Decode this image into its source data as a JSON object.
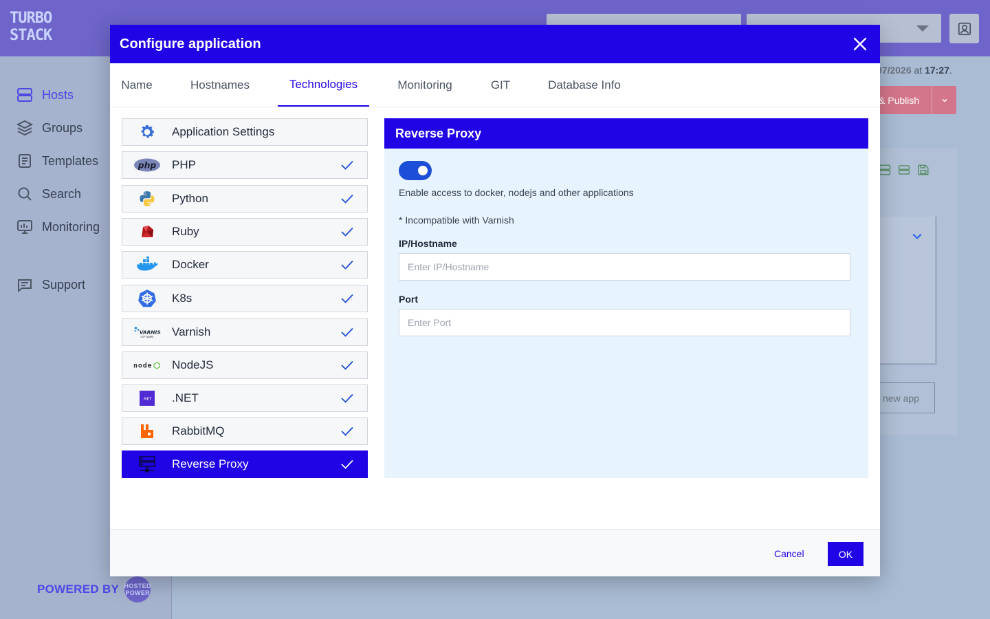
{
  "app": {
    "logo": "TURBO STACK",
    "powered_by": "POWERED BY"
  },
  "sidebar": {
    "items": [
      {
        "label": "Hosts",
        "icon": "server-icon"
      },
      {
        "label": "Groups",
        "icon": "layers-icon"
      },
      {
        "label": "Templates",
        "icon": "document-icon"
      },
      {
        "label": "Search",
        "icon": "search-icon"
      },
      {
        "label": "Monitoring",
        "icon": "monitor-icon"
      },
      {
        "label": "Support",
        "icon": "chat-icon"
      }
    ]
  },
  "background": {
    "date_text": "97/2026",
    "at_text": "at",
    "time_text": "17:27",
    "period": ".",
    "publish_label": "& Publish",
    "new_app_label": "l new app"
  },
  "modal": {
    "title": "Configure application",
    "tabs": [
      "Name",
      "Hostnames",
      "Technologies",
      "Monitoring",
      "GIT",
      "Database Info"
    ],
    "active_tab": "Technologies",
    "tech_items": [
      {
        "label": "Application Settings",
        "icon": "gear-icon"
      },
      {
        "label": "PHP",
        "icon": "php-icon"
      },
      {
        "label": "Python",
        "icon": "python-icon"
      },
      {
        "label": "Ruby",
        "icon": "ruby-icon"
      },
      {
        "label": "Docker",
        "icon": "docker-icon"
      },
      {
        "label": "K8s",
        "icon": "kubernetes-icon"
      },
      {
        "label": "Varnish",
        "icon": "varnish-icon"
      },
      {
        "label": "NodeJS",
        "icon": "nodejs-icon"
      },
      {
        "label": ".NET",
        "icon": "dotnet-icon"
      },
      {
        "label": "RabbitMQ",
        "icon": "rabbitmq-icon"
      },
      {
        "label": "Reverse Proxy",
        "icon": "reverse-proxy-icon"
      }
    ],
    "panel": {
      "title": "Reverse Proxy",
      "toggle_enabled": true,
      "description": "Enable access to docker, nodejs and other applications",
      "note": "* Incompatible with Varnish",
      "ip_label": "IP/Hostname",
      "ip_placeholder": "Enter IP/Hostname",
      "port_label": "Port",
      "port_placeholder": "Enter Port"
    },
    "footer": {
      "cancel_label": "Cancel",
      "ok_label": "OK"
    }
  },
  "colors": {
    "primary": "#2104e6",
    "topbar": "#6e64c9",
    "panel_bg": "#e8f4fd"
  },
  "php_text": "php",
  "varnish_text": "VARNISH",
  "varnish_sub": "SOFTWARE",
  "node_text": "node",
  "dotnet_text": ".NET",
  "powered_logo_text": "HOSTED POWER"
}
